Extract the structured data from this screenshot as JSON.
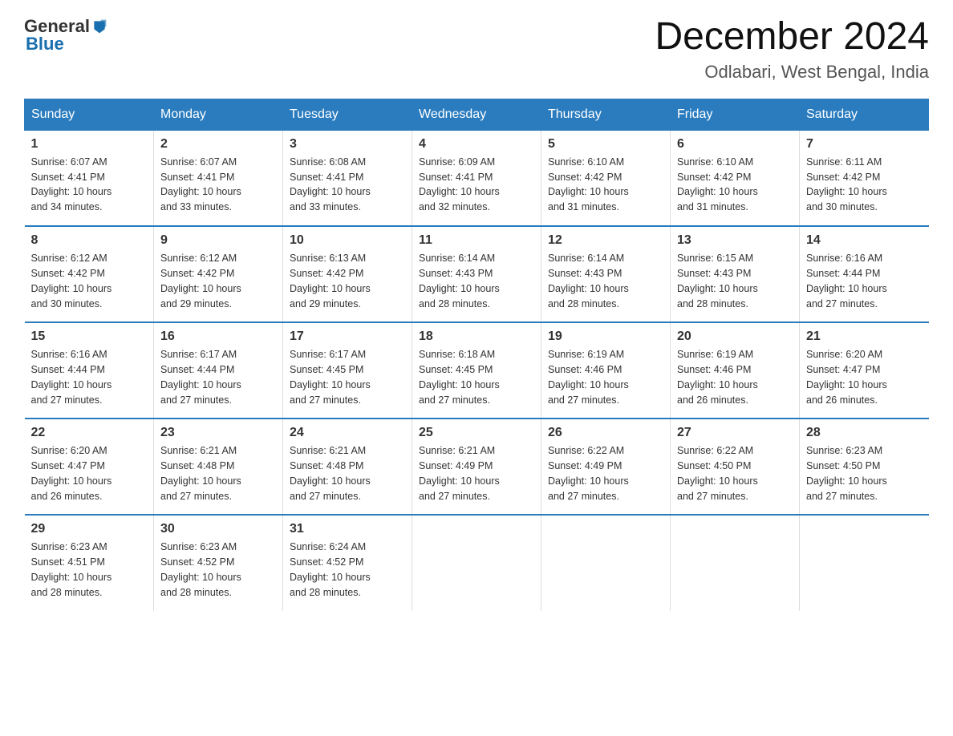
{
  "header": {
    "logo_general": "General",
    "logo_blue": "Blue",
    "month_title": "December 2024",
    "location": "Odlabari, West Bengal, India"
  },
  "days_of_week": [
    "Sunday",
    "Monday",
    "Tuesday",
    "Wednesday",
    "Thursday",
    "Friday",
    "Saturday"
  ],
  "weeks": [
    [
      {
        "day": "1",
        "sunrise": "6:07 AM",
        "sunset": "4:41 PM",
        "daylight": "10 hours and 34 minutes."
      },
      {
        "day": "2",
        "sunrise": "6:07 AM",
        "sunset": "4:41 PM",
        "daylight": "10 hours and 33 minutes."
      },
      {
        "day": "3",
        "sunrise": "6:08 AM",
        "sunset": "4:41 PM",
        "daylight": "10 hours and 33 minutes."
      },
      {
        "day": "4",
        "sunrise": "6:09 AM",
        "sunset": "4:41 PM",
        "daylight": "10 hours and 32 minutes."
      },
      {
        "day": "5",
        "sunrise": "6:10 AM",
        "sunset": "4:42 PM",
        "daylight": "10 hours and 31 minutes."
      },
      {
        "day": "6",
        "sunrise": "6:10 AM",
        "sunset": "4:42 PM",
        "daylight": "10 hours and 31 minutes."
      },
      {
        "day": "7",
        "sunrise": "6:11 AM",
        "sunset": "4:42 PM",
        "daylight": "10 hours and 30 minutes."
      }
    ],
    [
      {
        "day": "8",
        "sunrise": "6:12 AM",
        "sunset": "4:42 PM",
        "daylight": "10 hours and 30 minutes."
      },
      {
        "day": "9",
        "sunrise": "6:12 AM",
        "sunset": "4:42 PM",
        "daylight": "10 hours and 29 minutes."
      },
      {
        "day": "10",
        "sunrise": "6:13 AM",
        "sunset": "4:42 PM",
        "daylight": "10 hours and 29 minutes."
      },
      {
        "day": "11",
        "sunrise": "6:14 AM",
        "sunset": "4:43 PM",
        "daylight": "10 hours and 28 minutes."
      },
      {
        "day": "12",
        "sunrise": "6:14 AM",
        "sunset": "4:43 PM",
        "daylight": "10 hours and 28 minutes."
      },
      {
        "day": "13",
        "sunrise": "6:15 AM",
        "sunset": "4:43 PM",
        "daylight": "10 hours and 28 minutes."
      },
      {
        "day": "14",
        "sunrise": "6:16 AM",
        "sunset": "4:44 PM",
        "daylight": "10 hours and 27 minutes."
      }
    ],
    [
      {
        "day": "15",
        "sunrise": "6:16 AM",
        "sunset": "4:44 PM",
        "daylight": "10 hours and 27 minutes."
      },
      {
        "day": "16",
        "sunrise": "6:17 AM",
        "sunset": "4:44 PM",
        "daylight": "10 hours and 27 minutes."
      },
      {
        "day": "17",
        "sunrise": "6:17 AM",
        "sunset": "4:45 PM",
        "daylight": "10 hours and 27 minutes."
      },
      {
        "day": "18",
        "sunrise": "6:18 AM",
        "sunset": "4:45 PM",
        "daylight": "10 hours and 27 minutes."
      },
      {
        "day": "19",
        "sunrise": "6:19 AM",
        "sunset": "4:46 PM",
        "daylight": "10 hours and 27 minutes."
      },
      {
        "day": "20",
        "sunrise": "6:19 AM",
        "sunset": "4:46 PM",
        "daylight": "10 hours and 26 minutes."
      },
      {
        "day": "21",
        "sunrise": "6:20 AM",
        "sunset": "4:47 PM",
        "daylight": "10 hours and 26 minutes."
      }
    ],
    [
      {
        "day": "22",
        "sunrise": "6:20 AM",
        "sunset": "4:47 PM",
        "daylight": "10 hours and 26 minutes."
      },
      {
        "day": "23",
        "sunrise": "6:21 AM",
        "sunset": "4:48 PM",
        "daylight": "10 hours and 27 minutes."
      },
      {
        "day": "24",
        "sunrise": "6:21 AM",
        "sunset": "4:48 PM",
        "daylight": "10 hours and 27 minutes."
      },
      {
        "day": "25",
        "sunrise": "6:21 AM",
        "sunset": "4:49 PM",
        "daylight": "10 hours and 27 minutes."
      },
      {
        "day": "26",
        "sunrise": "6:22 AM",
        "sunset": "4:49 PM",
        "daylight": "10 hours and 27 minutes."
      },
      {
        "day": "27",
        "sunrise": "6:22 AM",
        "sunset": "4:50 PM",
        "daylight": "10 hours and 27 minutes."
      },
      {
        "day": "28",
        "sunrise": "6:23 AM",
        "sunset": "4:50 PM",
        "daylight": "10 hours and 27 minutes."
      }
    ],
    [
      {
        "day": "29",
        "sunrise": "6:23 AM",
        "sunset": "4:51 PM",
        "daylight": "10 hours and 28 minutes."
      },
      {
        "day": "30",
        "sunrise": "6:23 AM",
        "sunset": "4:52 PM",
        "daylight": "10 hours and 28 minutes."
      },
      {
        "day": "31",
        "sunrise": "6:24 AM",
        "sunset": "4:52 PM",
        "daylight": "10 hours and 28 minutes."
      },
      null,
      null,
      null,
      null
    ]
  ],
  "labels": {
    "sunrise": "Sunrise:",
    "sunset": "Sunset:",
    "daylight": "Daylight:"
  }
}
